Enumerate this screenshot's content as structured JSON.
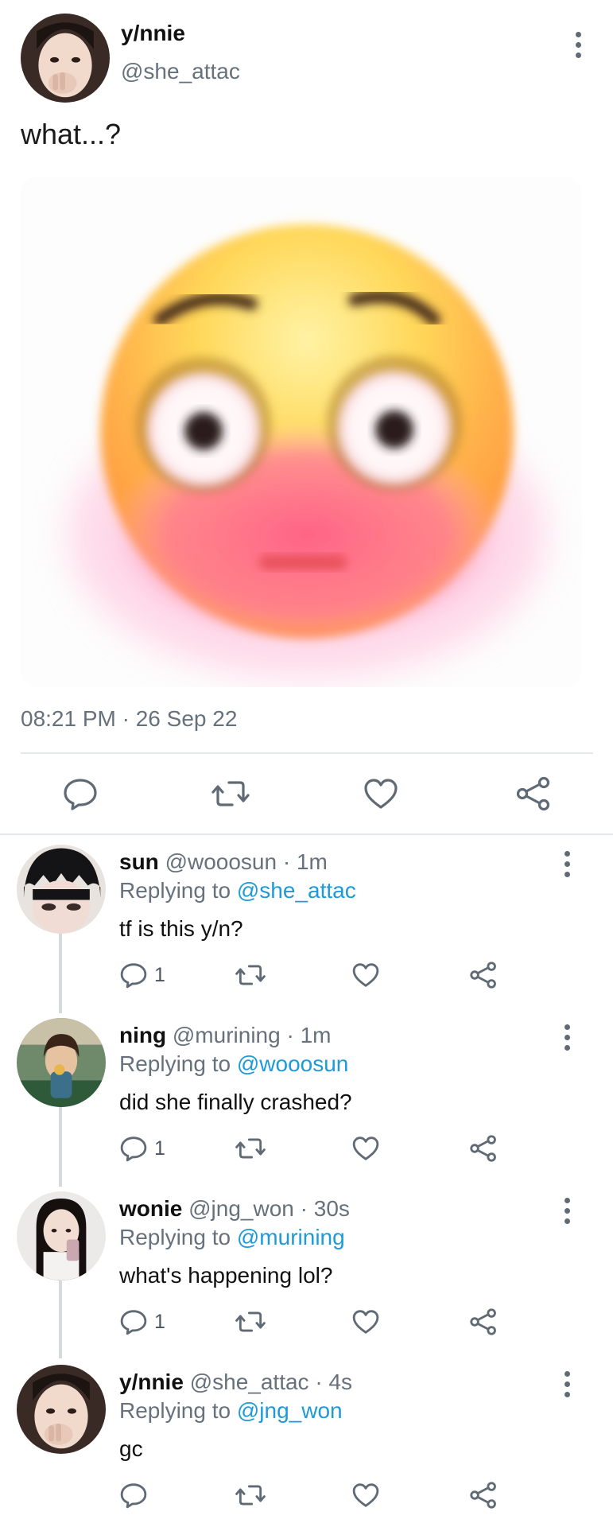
{
  "tweet": {
    "display_name": "y/nnie",
    "handle": "@she_attac",
    "text": "what...?",
    "timestamp": "08:21 PM · 26 Sep 22",
    "media_icon": "flushed-face-emoji",
    "actions": {
      "reply_icon": "reply-icon",
      "retweet_icon": "retweet-icon",
      "like_icon": "heart-icon",
      "share_icon": "share-icon"
    }
  },
  "replies": [
    {
      "name": "sun",
      "handle": "@wooosun",
      "time": "1m",
      "replying_label": "Replying to",
      "replying_to": "@she_attac",
      "text": "tf is this y/n?",
      "reply_count": "1"
    },
    {
      "name": "ning",
      "handle": "@murining",
      "time": "1m",
      "replying_label": "Replying to",
      "replying_to": "@wooosun",
      "text": "did she finally crashed?",
      "reply_count": "1"
    },
    {
      "name": "wonie",
      "handle": "@jng_won",
      "time": "30s",
      "replying_label": "Replying to",
      "replying_to": "@murining",
      "text": "what's happening lol?",
      "reply_count": "1"
    },
    {
      "name": "y/nnie",
      "handle": "@she_attac",
      "time": "4s",
      "replying_label": "Replying to",
      "replying_to": "@jng_won",
      "text": "gc",
      "reply_count": ""
    }
  ],
  "colors": {
    "accent_link": "#1d9bd8",
    "muted_text": "#66717c",
    "divider": "#e6e9ec"
  }
}
